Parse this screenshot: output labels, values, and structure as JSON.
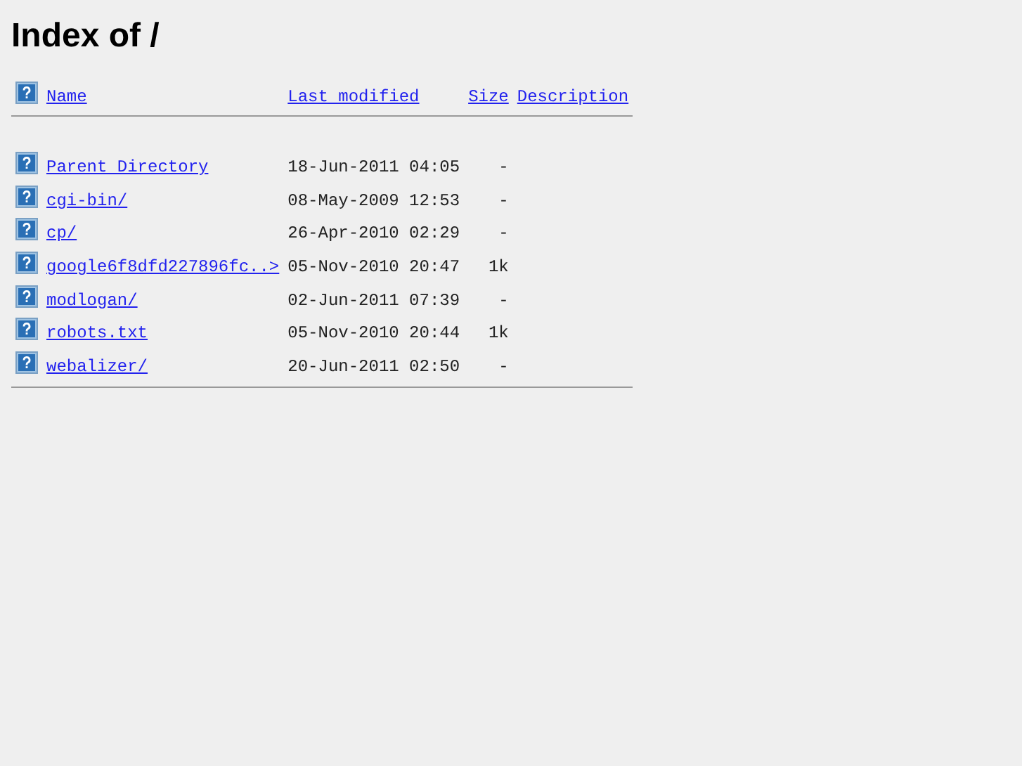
{
  "title": "Index of /",
  "columns": [
    "Name",
    "Last modified",
    "Size",
    "Description"
  ],
  "rows": [
    {
      "name": "Parent Directory",
      "modified": "18-Jun-2011 04:05",
      "size": "-"
    },
    {
      "name": "cgi-bin/",
      "modified": "08-May-2009 12:53",
      "size": "-"
    },
    {
      "name": "cp/",
      "modified": "26-Apr-2010 02:29",
      "size": "-"
    },
    {
      "name": "google6f8dfd227896fc..>",
      "modified": "05-Nov-2010 20:47",
      "size": "1k"
    },
    {
      "name": "modlogan/",
      "modified": "02-Jun-2011 07:39",
      "size": "-"
    },
    {
      "name": "robots.txt",
      "modified": "05-Nov-2010 20:44",
      "size": "1k"
    },
    {
      "name": "webalizer/",
      "modified": "20-Jun-2011 02:50",
      "size": "-"
    }
  ]
}
